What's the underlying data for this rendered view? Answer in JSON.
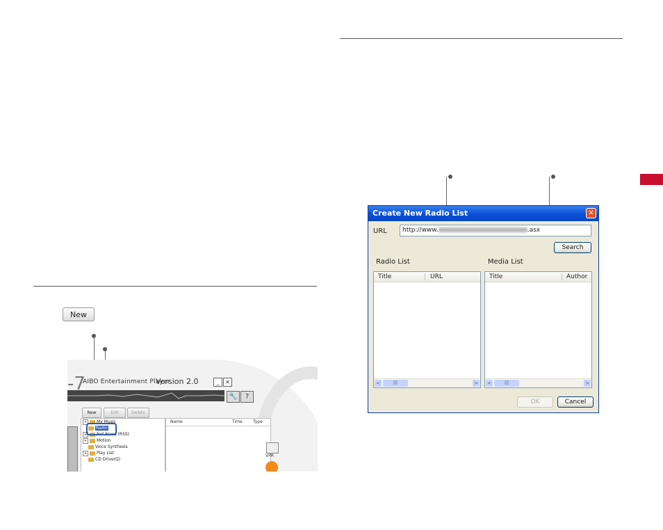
{
  "sample_button": {
    "label": "New"
  },
  "player": {
    "brand_mark": "-7",
    "title": "AIBO Entertainment Player",
    "version": "Version 2.0",
    "minimize_glyph": "_",
    "close_glyph": "✕",
    "tool_glyph": "🔧",
    "help_glyph": "?",
    "buttons": {
      "new": "New",
      "edit": "Edit",
      "delete": "Delete"
    },
    "tree": [
      {
        "label": "My Music",
        "expander": "+"
      },
      {
        "label": "Radio",
        "expander": ""
      },
      {
        "label": "Net News (RSS)",
        "expander": "+"
      },
      {
        "label": "Motion",
        "expander": "+"
      },
      {
        "label": "Voice Synthesis",
        "expander": ""
      },
      {
        "label": "Play List",
        "expander": "+"
      },
      {
        "label": "CD Drive(Q)",
        "expander": ""
      }
    ],
    "list_columns": [
      "Name",
      "Time",
      "Type"
    ],
    "vpr_label": "VPR"
  },
  "dialog": {
    "title": "Create New Radio List",
    "close_glyph": "✕",
    "url_label": "URL",
    "url_value_prefix": "http://www.",
    "url_value_suffix": ".asx",
    "search_button": "Search",
    "radio_list_label": "Radio List",
    "media_list_label": "Media List",
    "radio_columns": [
      "Title",
      "URL"
    ],
    "media_columns": [
      "Title",
      "Author"
    ],
    "ok_button": "OK",
    "cancel_button": "Cancel",
    "scroll_left": "<",
    "scroll_right": ">",
    "scroll_grip": "|||"
  },
  "colors": {
    "side_tab": "#c8102e",
    "titlebar": "#0a4fd6",
    "radio_ring": "#2e5aa8"
  }
}
